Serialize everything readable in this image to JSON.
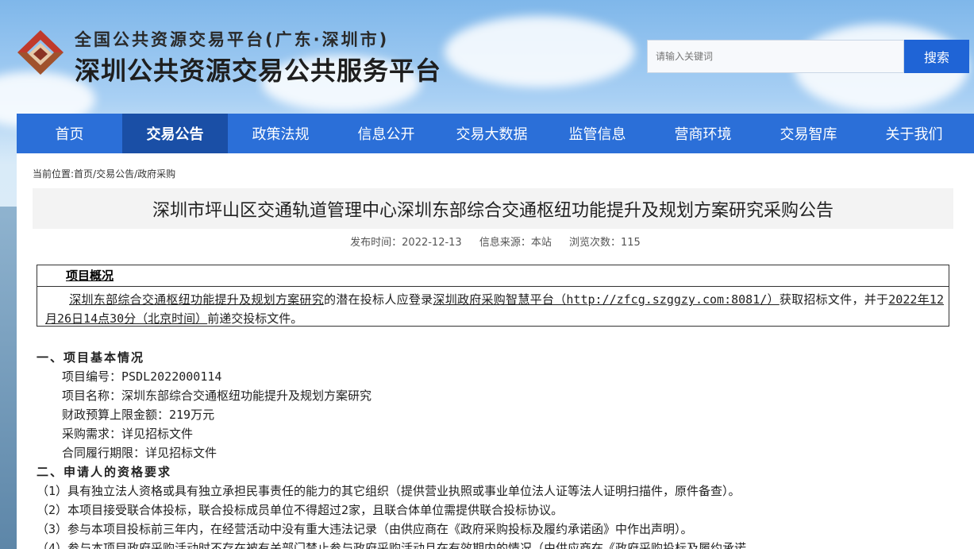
{
  "header": {
    "title_top": "全国公共资源交易平台(广东·深圳市)",
    "title_main": "深圳公共资源交易公共服务平台",
    "search_placeholder": "请输入关键词",
    "search_button": "搜索"
  },
  "nav": {
    "items": [
      "首页",
      "交易公告",
      "政策法规",
      "信息公开",
      "交易大数据",
      "监管信息",
      "营商环境",
      "交易智库",
      "关于我们"
    ],
    "active": "交易公告"
  },
  "breadcrumb": "当前位置:首页/交易公告/政府采购",
  "article": {
    "title": "深圳市坪山区交通轨道管理中心深圳东部综合交通枢纽功能提升及规划方案研究采购公告",
    "publish_time": "发布时间：2022-12-13",
    "source": "信息来源：本站",
    "views": "浏览次数：115"
  },
  "overview": {
    "heading": "项目概况",
    "project_name": "深圳东部综合交通枢纽功能提升及规划方案研究",
    "text1": "的潜在投标人应登录",
    "platform": "深圳政府采购智慧平台（http://zfcg.szggzy.com:8081/）",
    "text2": "获取招标文件，并于",
    "deadline": "2022年12月26日14点30分（北京时间）",
    "text3": "前递交投标文件。"
  },
  "section1": {
    "heading": "一、项目基本情况",
    "lines": [
      "项目编号：PSDL2022000114",
      "项目名称：深圳东部综合交通枢纽功能提升及规划方案研究",
      "财政预算上限金额：219万元",
      "采购需求：详见招标文件",
      "合同履行期限：详见招标文件"
    ]
  },
  "section2": {
    "heading": "二、申请人的资格要求",
    "lines": [
      "（1）具有独立法人资格或具有独立承担民事责任的能力的其它组织（提供营业执照或事业单位法人证等法人证明扫描件，原件备查）。",
      "（2）本项目接受联合体投标，联合投标成员单位不得超过2家，且联合体单位需提供联合投标协议。",
      "（3）参与本项目投标前三年内，在经营活动中没有重大违法记录（由供应商在《政府采购投标及履约承诺函》中作出声明）。",
      "（4）参与本项目政府采购活动时不存在被有关部门禁止参与政府采购活动且在有效期内的情况（由供应商在《政府采购投标及履约承诺"
    ]
  }
}
